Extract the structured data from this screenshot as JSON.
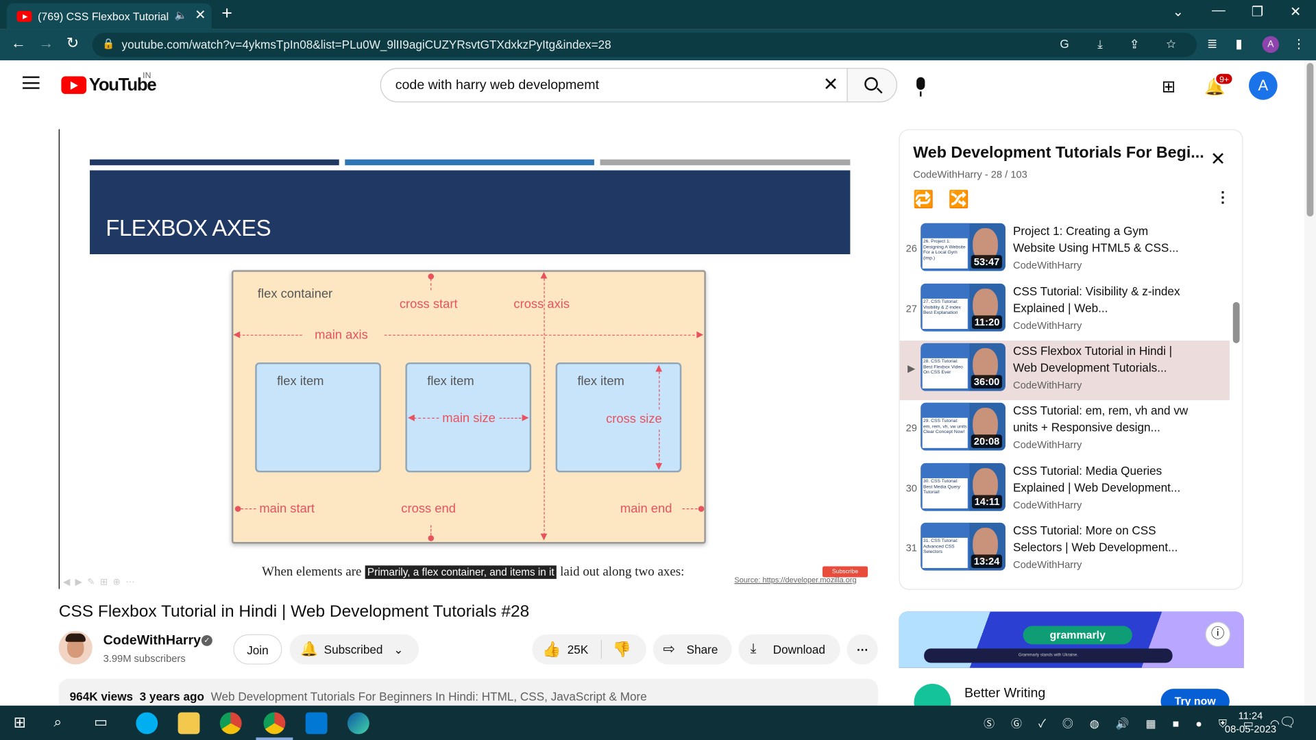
{
  "browser": {
    "tab_title": "(769) CSS Flexbox Tutorial in",
    "url": "youtube.com/watch?v=4ykmsTpIn08&list=PLu0W_9lII9agiCUZYRsvtGTXdxkzPyItg&index=28"
  },
  "header": {
    "logo_text": "YouTube",
    "country": "IN",
    "search_value": "code with harry web developmemt",
    "notif_count": "9+",
    "avatar_letter": "A"
  },
  "slide": {
    "heading": "FLEXBOX AXES",
    "labels": {
      "flex_container": "flex container",
      "cross_start": "cross start",
      "cross_axis": "cross axis",
      "main_axis": "main axis",
      "flex_item": "flex item",
      "main_size": "main size",
      "cross_size": "cross size",
      "main_start": "main start",
      "cross_end": "cross end",
      "main_end": "main end"
    },
    "caption_before": "When elements are",
    "caption_boxed": "Primarily, a flex container, and items in it",
    "caption_after": "laid out along two axes:",
    "source": "Source: https://developer.mozilla.org",
    "mini_subscribe": "Subscribe",
    "bar_colors": [
      "#1f3864",
      "#2e75b6",
      "#a6a6a6"
    ]
  },
  "video": {
    "title": "CSS Flexbox Tutorial in Hindi | Web Development Tutorials #28",
    "channel": "CodeWithHarry",
    "subscribers": "3.99M subscribers",
    "join": "Join",
    "subscribed": "Subscribed",
    "likes": "25K",
    "share": "Share",
    "download": "Download",
    "views": "964K views",
    "age": "3 years ago",
    "playlist_link": "Web Development Tutorials For Beginners In Hindi: HTML, CSS, JavaScript & More"
  },
  "playlist": {
    "title": "Web Development Tutorials For Begi...",
    "meta": "CodeWithHarry - 28 / 103",
    "items": [
      {
        "index": "26",
        "title": "Project 1: Creating a Gym Website Using HTML5 & CSS...",
        "channel": "CodeWithHarry",
        "duration": "53:47",
        "thumb_text": "26. Project 1: Designing A Website For a Local Gym (imp.)",
        "active": false
      },
      {
        "index": "27",
        "title": "CSS Tutorial: Visibility & z-index Explained | Web...",
        "channel": "CodeWithHarry",
        "duration": "11:20",
        "thumb_text": "27. CSS Tutorial: Visibility & Z-index Best Explanation",
        "active": false
      },
      {
        "index": "▶",
        "title": "CSS Flexbox Tutorial in Hindi | Web Development Tutorials...",
        "channel": "CodeWithHarry",
        "duration": "36:00",
        "thumb_text": "28. CSS Tutorial: Best Flexbox Video On CSS Ever",
        "active": true
      },
      {
        "index": "29",
        "title": "CSS Tutorial: em, rem, vh and vw units + Responsive design...",
        "channel": "CodeWithHarry",
        "duration": "20:08",
        "thumb_text": "29. CSS Tutorial: em, rem, vh, vw units Clear Concept Now!",
        "active": false
      },
      {
        "index": "30",
        "title": "CSS Tutorial: Media Queries Explained | Web Development...",
        "channel": "CodeWithHarry",
        "duration": "14:11",
        "thumb_text": "30. CSS Tutorial: Best Media Query Tutorial!",
        "active": false
      },
      {
        "index": "31",
        "title": "CSS Tutorial: More on CSS Selectors | Web Development...",
        "channel": "CodeWithHarry",
        "duration": "13:24",
        "thumb_text": "31. CSS Tutorial: Advanced CSS Selectors",
        "active": false
      }
    ]
  },
  "ad": {
    "brand": "grammarly",
    "tagline": "Grammarly stands with Ukraine.",
    "headline": "Better Writing",
    "cta": "Try now"
  },
  "taskbar": {
    "time": "11:24",
    "date": "08-05-2023"
  }
}
